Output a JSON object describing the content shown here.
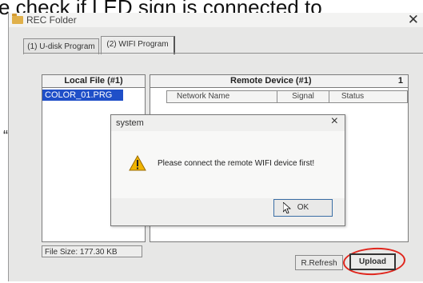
{
  "overlay_caption": "e check if LED sign is connected to",
  "stray_mark": "“",
  "window": {
    "title": "REC Folder",
    "tabs": [
      "(1) U-disk Program",
      "(2) WIFI Program"
    ],
    "local_file_header": "Local File (#1)",
    "local_files": [
      "COLOR_01.PRG"
    ],
    "file_size": "File Size: 177.30 KB",
    "remote_header": "Remote Device (#1)",
    "remote_count": "1",
    "remote_columns": [
      "Network Name",
      "Signal",
      "Status"
    ],
    "buttons": {
      "refresh": "R.Refresh",
      "upload": "Upload"
    }
  },
  "dialog": {
    "title": "system",
    "message": "Please connect the remote WIFI device first!",
    "ok": "OK"
  },
  "icons": {
    "window_icon": "folder-icon",
    "dialog_icon": "warning-icon",
    "pointer": "mouse-cursor-icon"
  },
  "colors": {
    "selection": "#1f4fc8",
    "annotation_circle": "#e0251c",
    "warning": "#f0b400"
  }
}
